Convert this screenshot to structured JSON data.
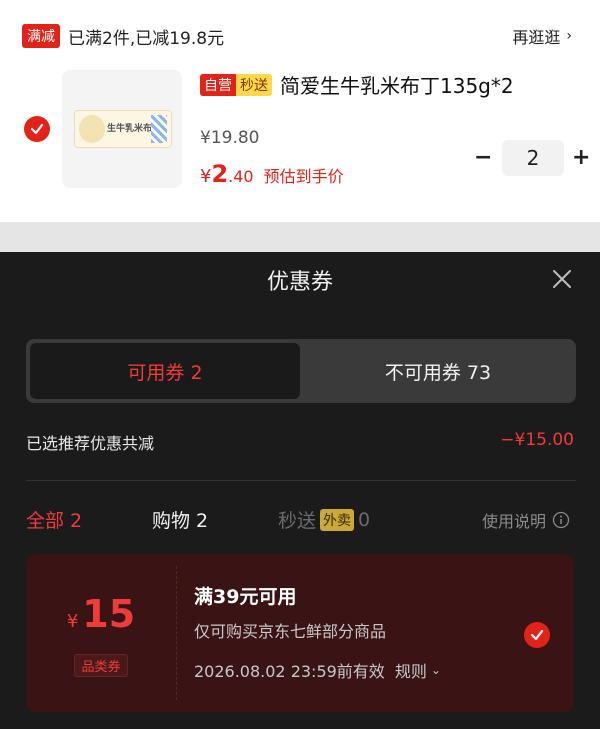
{
  "cart": {
    "promo_tag": "满减",
    "promo_text": "已满2件,已减19.8元",
    "browse_label": "再逛逛",
    "product": {
      "tag_self": "自营",
      "tag_fast": "秒送",
      "title": "简爱生牛乳米布丁135g*2",
      "image_label": "生牛乳米布丁",
      "price_original": "¥19.80",
      "price_final_yen": "¥",
      "price_final_int": "2",
      "price_final_dec": ".40",
      "price_final_note": "预估到手价",
      "quantity": "2",
      "qty_minus": "−",
      "qty_plus": "+"
    }
  },
  "coupon_sheet": {
    "title": "优惠券",
    "tabs": {
      "available": "可用券 2",
      "unavailable": "不可用券 73"
    },
    "saving_label": "已选推荐优惠共减",
    "saving_amount": "−¥15.00",
    "filters": {
      "all": "全部 2",
      "shopping": "购物 2",
      "fast_prefix": "秒送",
      "fast_tag": "外卖",
      "fast_count": "0",
      "help": "使用说明"
    },
    "coupon": {
      "currency": "¥",
      "amount": "15",
      "category_tag": "品类券",
      "condition": "满39元可用",
      "scope": "仅可购买京东七鲜部分商品",
      "validity": "2026.08.02 23:59前有效",
      "rule_label": "规则",
      "selected": true
    }
  },
  "colors": {
    "brand_red": "#e2231a",
    "sheet_bg": "#1b1b1b",
    "coupon_bg": "#3a1414"
  }
}
